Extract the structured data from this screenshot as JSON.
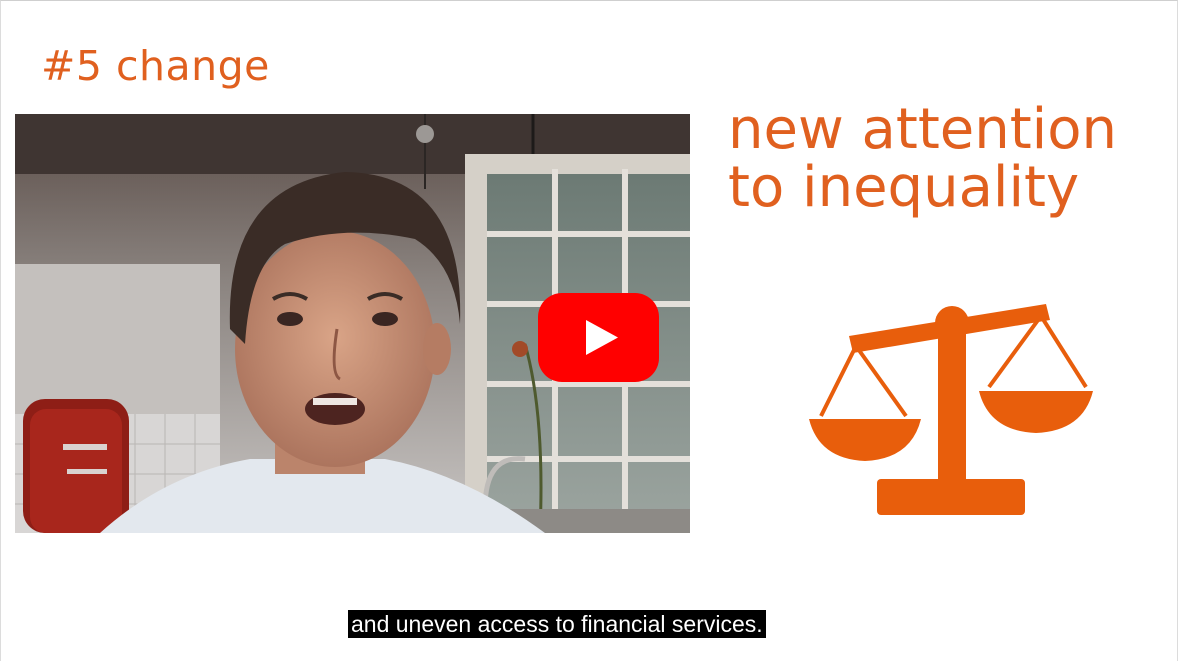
{
  "slide": {
    "heading": "#5 change",
    "headline_line1": "new attention",
    "headline_line2": "to inequality"
  },
  "video": {
    "play_button_icon": "youtube-play-icon",
    "play_button_color": "#ff0000"
  },
  "illustration": {
    "icon": "balance-scale-icon",
    "color": "#e85e0c"
  },
  "captions": {
    "current": "and uneven access to financial services."
  },
  "colors": {
    "accent": "#e0601f"
  }
}
